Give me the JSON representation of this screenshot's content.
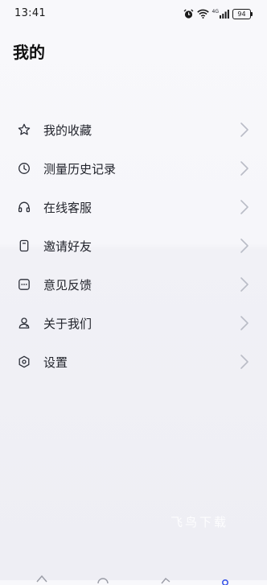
{
  "status_bar": {
    "time": "13:41",
    "network_label": "4G",
    "battery_level": "94"
  },
  "page": {
    "title": "我的"
  },
  "menu": {
    "items": [
      {
        "label": "我的收藏",
        "icon": "star-icon"
      },
      {
        "label": "测量历史记录",
        "icon": "clock-icon"
      },
      {
        "label": "在线客服",
        "icon": "headset-icon"
      },
      {
        "label": "邀请好友",
        "icon": "phone-icon"
      },
      {
        "label": "意见反馈",
        "icon": "chat-icon"
      },
      {
        "label": "关于我们",
        "icon": "user-icon"
      },
      {
        "label": "设置",
        "icon": "hexagon-settings-icon"
      }
    ]
  },
  "watermark": {
    "text": "飞鸟下载"
  },
  "colors": {
    "text_primary": "#22242c",
    "icon_stroke": "#2b2e38",
    "chevron": "#b9bcc6",
    "background": "#f3f3f8"
  }
}
